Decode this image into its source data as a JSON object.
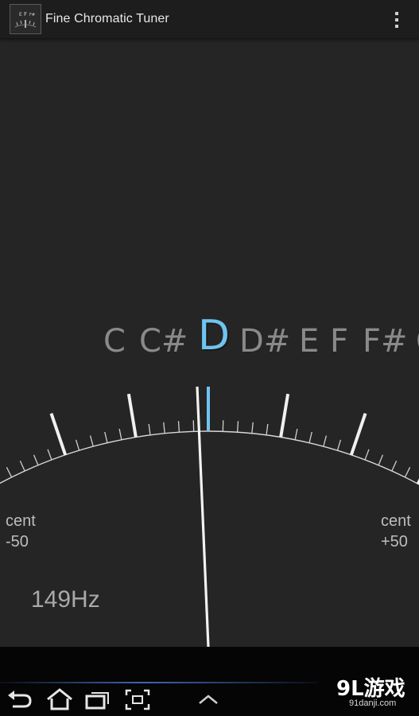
{
  "app": {
    "title": "Fine Chromatic Tuner",
    "icon": "tuner-app-icon",
    "menu_icon": "overflow-menu-icon"
  },
  "tuner": {
    "notes": [
      "C",
      "C#",
      "D",
      "D#",
      "E",
      "F",
      "F#",
      "G"
    ],
    "active_note": "D",
    "cent_left_label": "cent",
    "cent_left_value": "-50",
    "cent_right_label": "cent",
    "cent_right_value": "+50",
    "frequency": "149Hz",
    "needle_cents": 0,
    "accent_color": "#6fc4f0"
  },
  "navbar": {
    "buttons": [
      "back-icon",
      "home-icon",
      "recent-apps-icon",
      "screenshot-icon",
      "chevron-up-icon"
    ]
  },
  "watermark": {
    "brand": "9L游戏",
    "site": "91danji.com"
  }
}
